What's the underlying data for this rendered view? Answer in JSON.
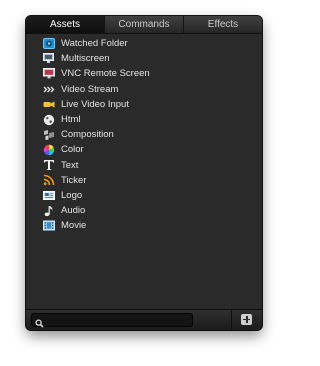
{
  "tabs": [
    "Assets",
    "Commands",
    "Effects"
  ],
  "active_tab": "Assets",
  "assets": [
    {
      "label": "Watched Folder",
      "icon": "watched-folder-icon"
    },
    {
      "label": "Multiscreen",
      "icon": "multiscreen-icon"
    },
    {
      "label": "VNC Remote Screen",
      "icon": "vnc-remote-screen-icon"
    },
    {
      "label": "Video Stream",
      "icon": "video-stream-icon"
    },
    {
      "label": "Live Video Input",
      "icon": "live-video-input-icon"
    },
    {
      "label": "Html",
      "icon": "html-icon"
    },
    {
      "label": "Composition",
      "icon": "composition-icon"
    },
    {
      "label": "Color",
      "icon": "color-icon"
    },
    {
      "label": "Text",
      "icon": "text-icon"
    },
    {
      "label": "Ticker",
      "icon": "ticker-icon"
    },
    {
      "label": "Logo",
      "icon": "logo-icon"
    },
    {
      "label": "Audio",
      "icon": "audio-icon"
    },
    {
      "label": "Movie",
      "icon": "movie-icon"
    }
  ],
  "search": {
    "value": "",
    "icon": "search-icon"
  },
  "add_button": {
    "icon": "plus-icon"
  }
}
